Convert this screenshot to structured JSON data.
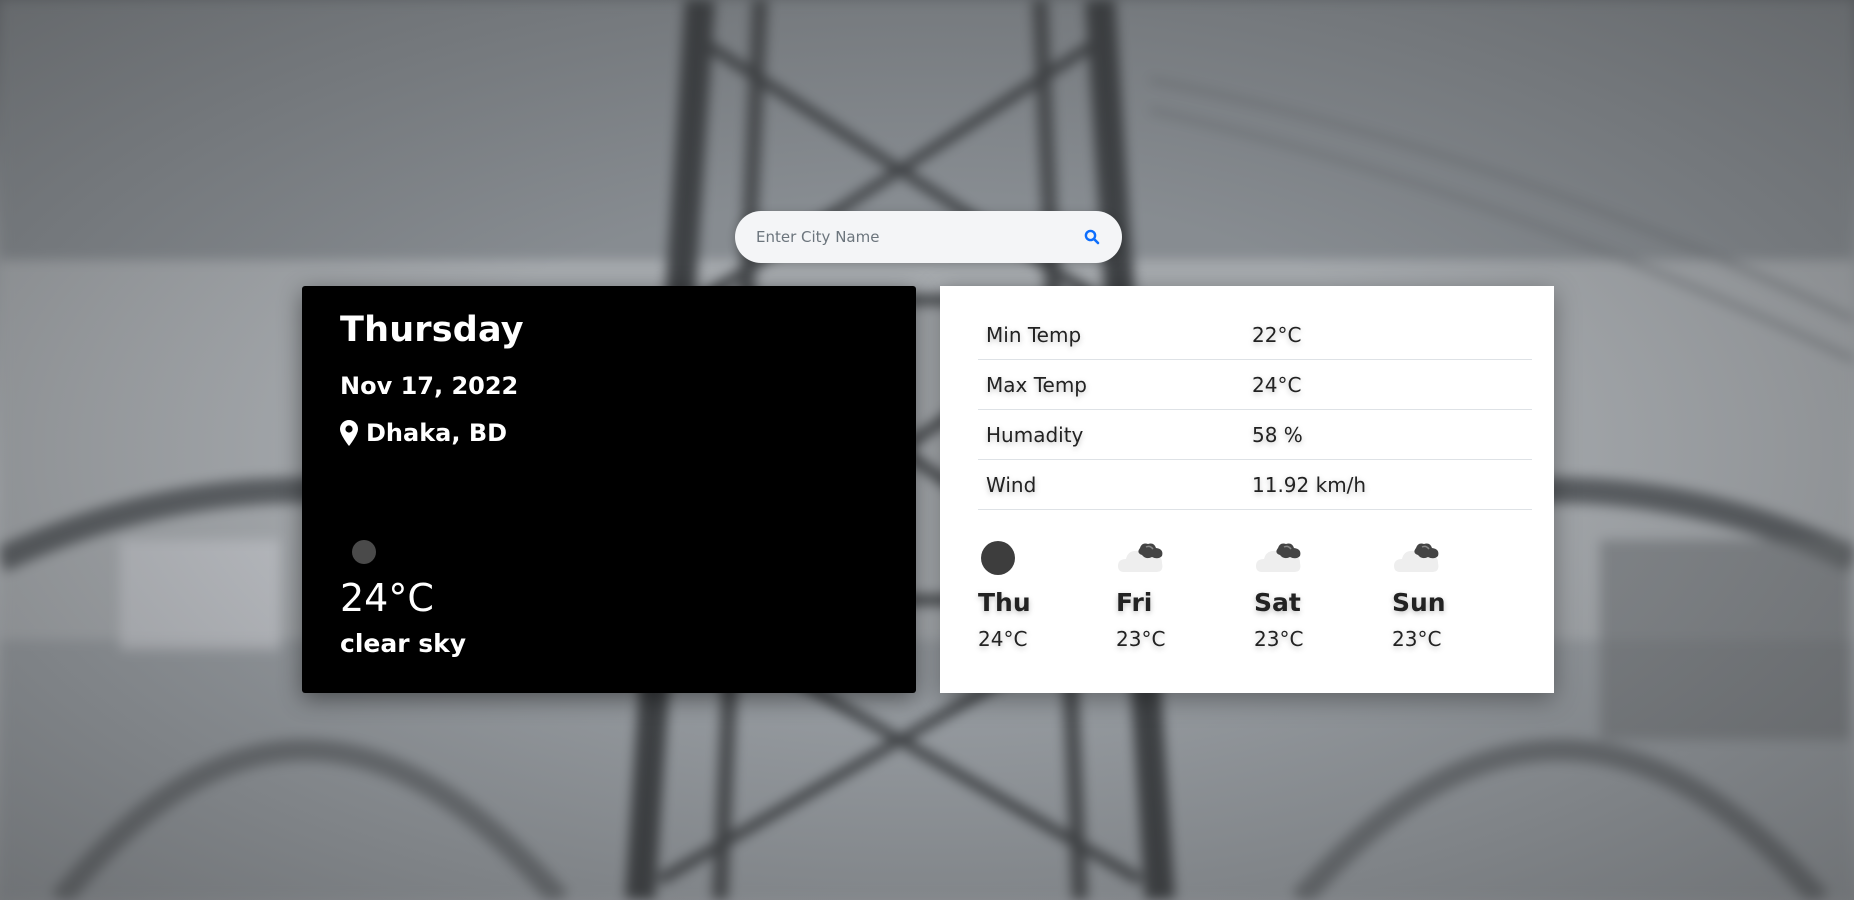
{
  "search": {
    "placeholder": "Enter City Name",
    "value": "",
    "button_icon": "search-icon"
  },
  "current": {
    "day": "Thursday",
    "date": "Nov 17, 2022",
    "location": "Dhaka, BD",
    "location_icon": "map-pin-icon",
    "weather_icon": "moon-icon",
    "temp": "24°C",
    "description": "clear sky"
  },
  "details": [
    {
      "label": "Min Temp",
      "value": "22°C"
    },
    {
      "label": "Max Temp",
      "value": "24°C"
    },
    {
      "label": "Humadity",
      "value": "58 %"
    },
    {
      "label": "Wind",
      "value": "11.92 km/h"
    }
  ],
  "forecast": [
    {
      "day": "Thu",
      "temp": "24°C",
      "icon": "moon-icon"
    },
    {
      "day": "Fri",
      "temp": "23°C",
      "icon": "cloud-icon"
    },
    {
      "day": "Sat",
      "temp": "23°C",
      "icon": "cloud-icon"
    },
    {
      "day": "Sun",
      "temp": "23°C",
      "icon": "cloud-icon"
    }
  ],
  "colors": {
    "accent": "#0d6efd",
    "card_dark": "#000000",
    "card_light": "#ffffff"
  }
}
